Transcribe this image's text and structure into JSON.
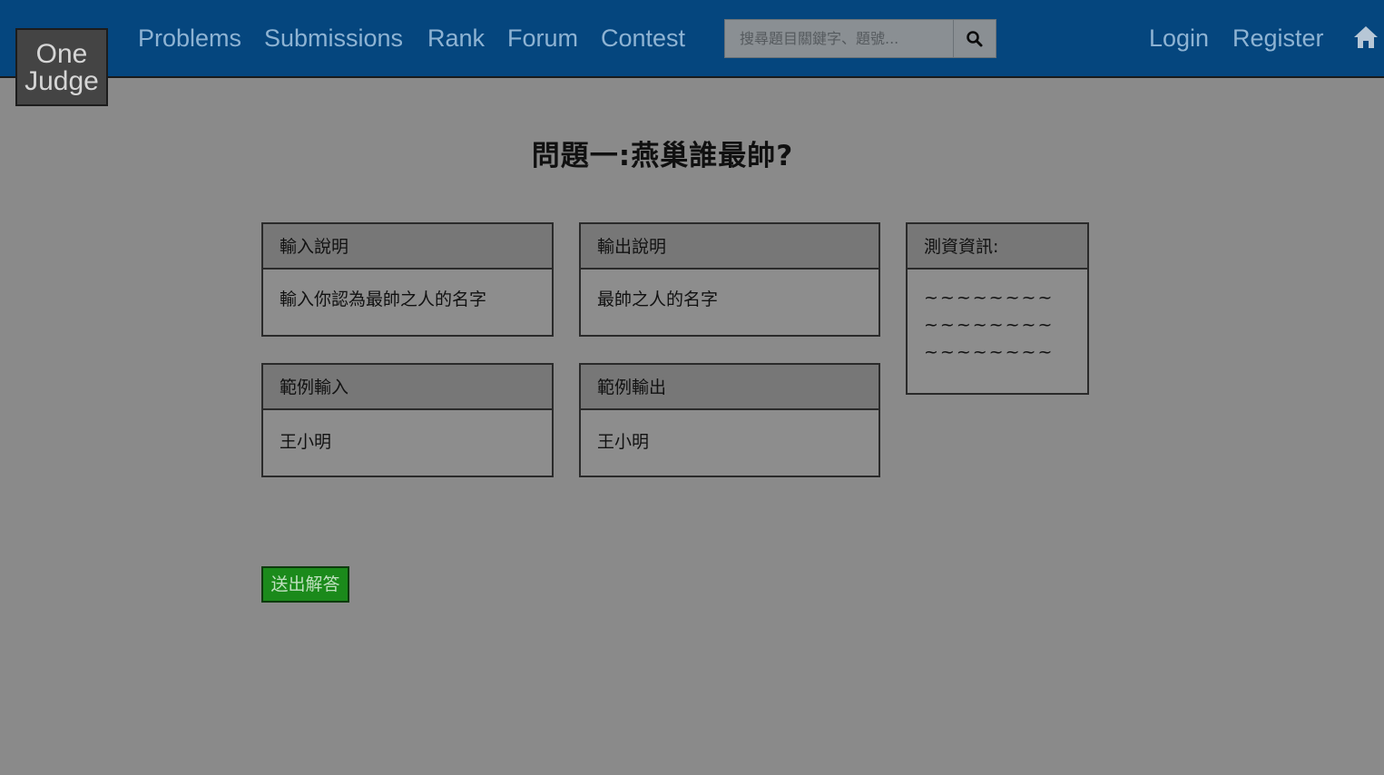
{
  "logo": {
    "line1": "One",
    "line2": "Judge"
  },
  "nav": {
    "problems": "Problems",
    "submissions": "Submissions",
    "rank": "Rank",
    "forum": "Forum",
    "contest": "Contest",
    "login": "Login",
    "register": "Register"
  },
  "search": {
    "placeholder": "搜尋題目關鍵字、題號...",
    "icon": "search-icon"
  },
  "home_icon": "home-icon",
  "problem": {
    "title": "問題一:燕巢誰最帥?",
    "input_desc": {
      "header": "輸入說明",
      "body": "輸入你認為最帥之人的名字"
    },
    "output_desc": {
      "header": "輸出說明",
      "body": "最帥之人的名字"
    },
    "test_info": {
      "header": "測資資訊:",
      "lines": [
        "~~~~~~~~",
        "~~~~~~~~",
        "~~~~~~~~"
      ]
    },
    "sample_input": {
      "header": "範例輸入",
      "body": "王小明"
    },
    "sample_output": {
      "header": "範例輸出",
      "body": "王小明"
    }
  },
  "submit_label": "送出解答",
  "colors": {
    "navbar": "#05467e",
    "overlay_background": "#8a8a8a",
    "submit_button": "#1b8a1b"
  }
}
